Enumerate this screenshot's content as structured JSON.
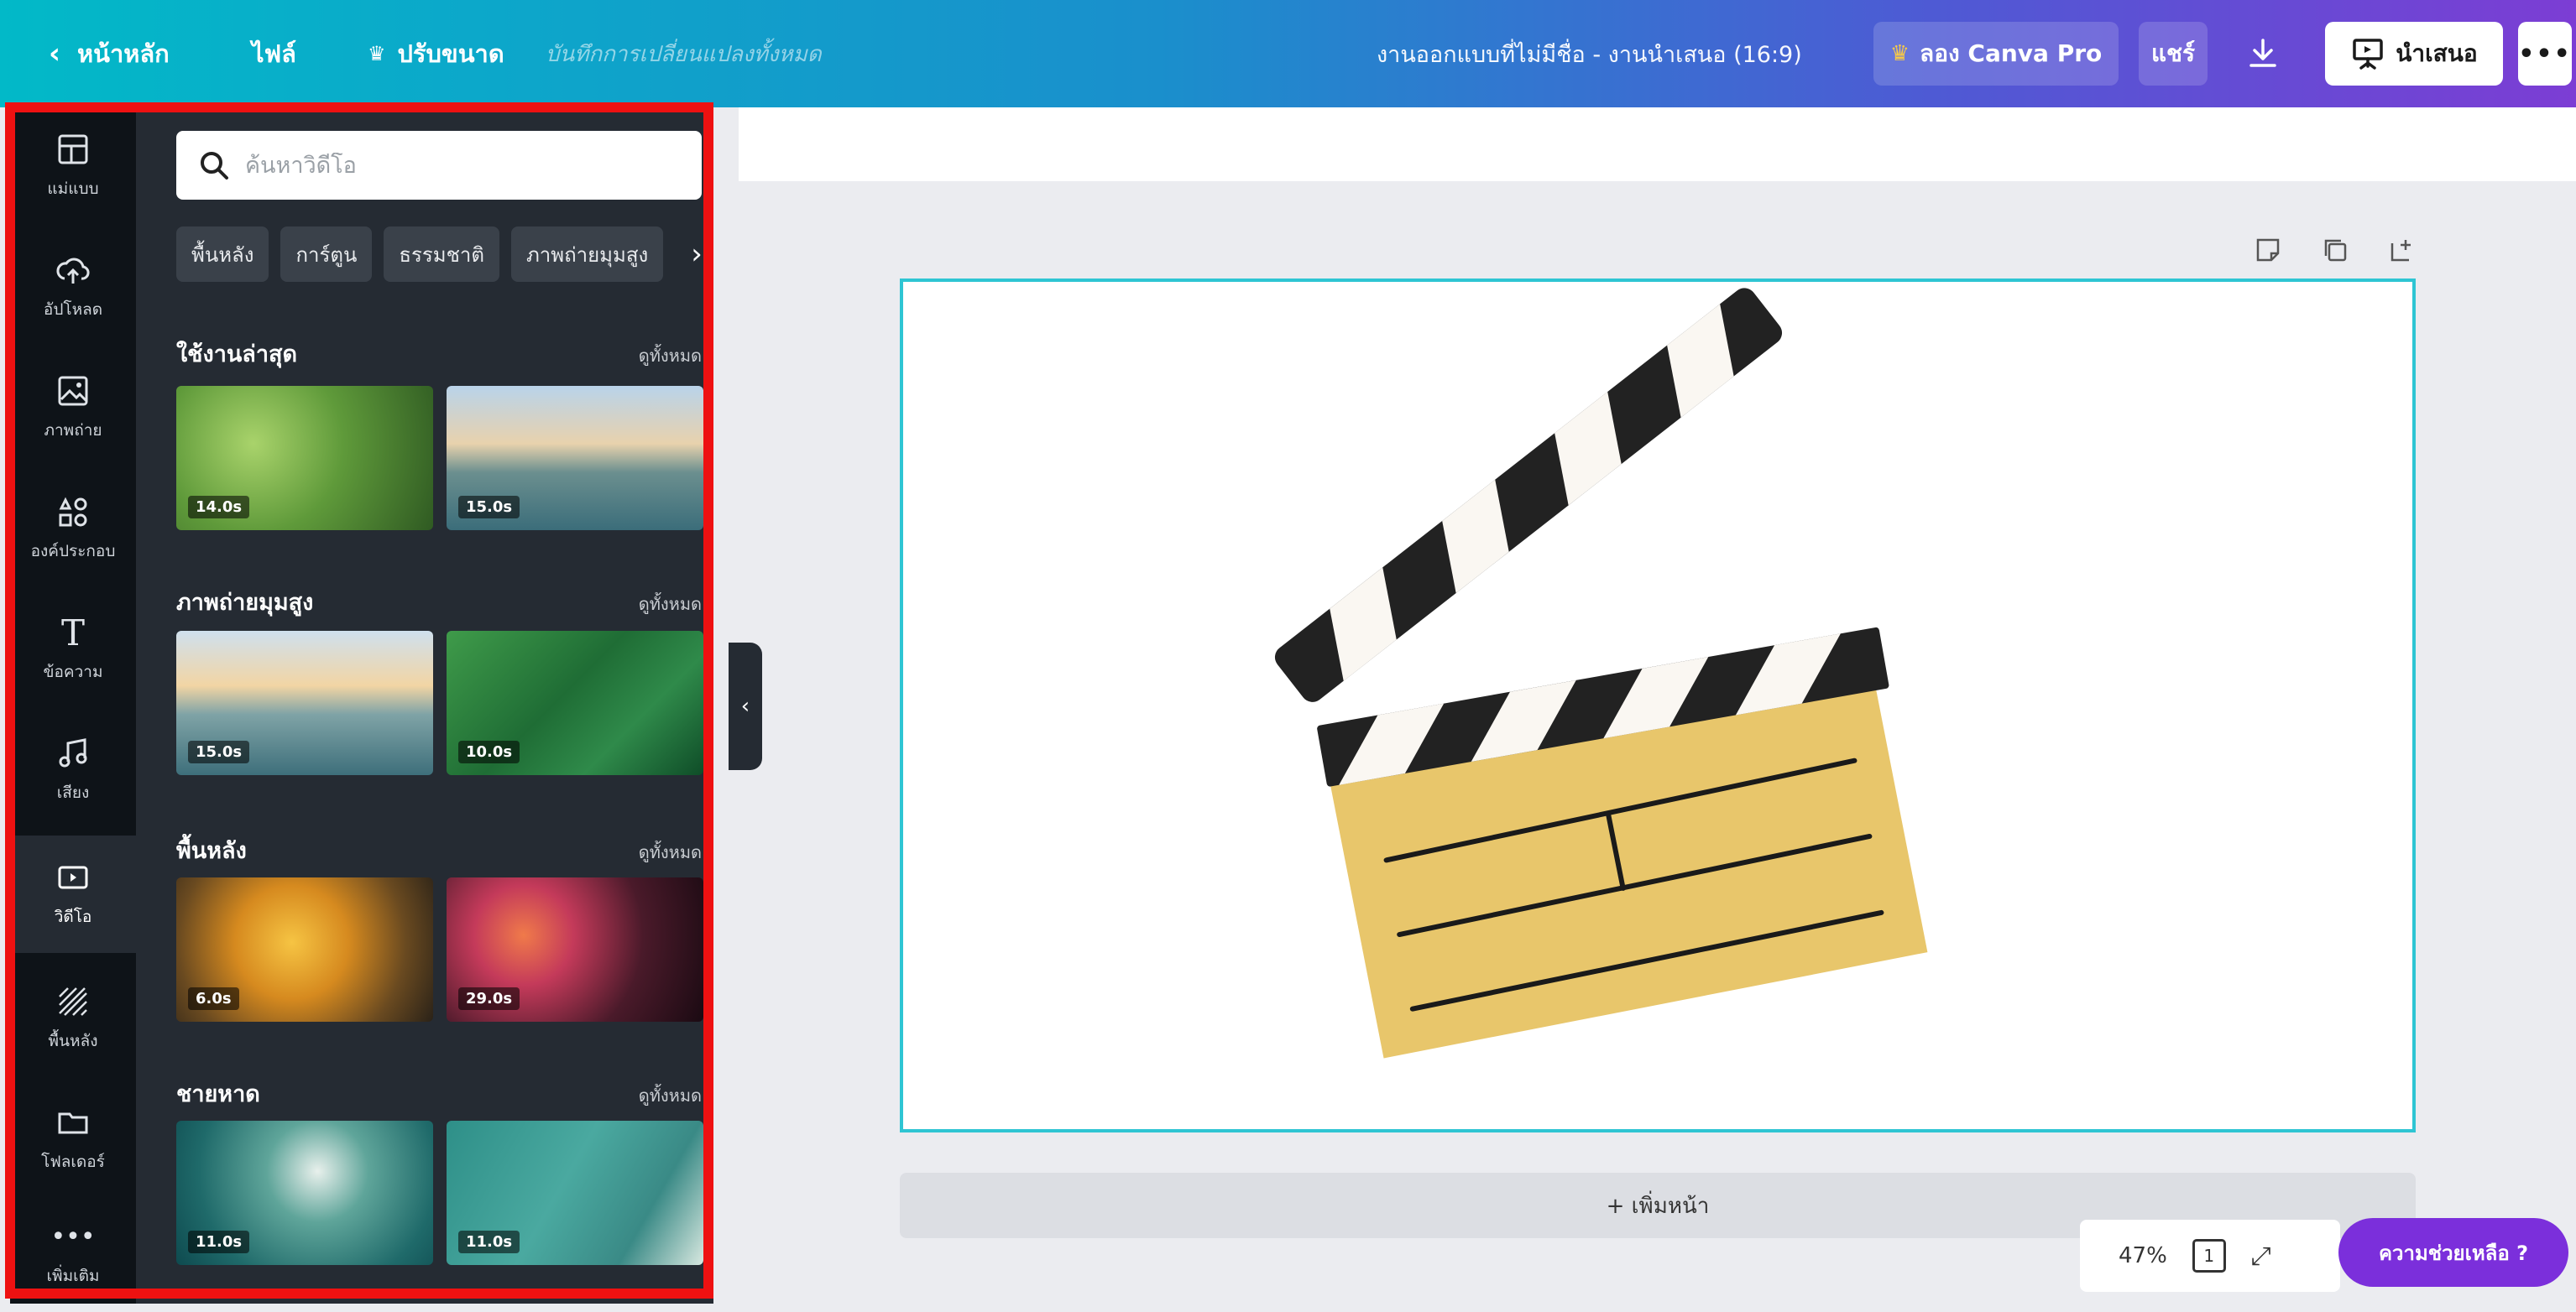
{
  "topbar": {
    "back_label": "หน้าหลัก",
    "file_label": "ไฟล์",
    "resize_label": "ปรับขนาด",
    "saved_status": "บันทึกการเปลี่ยนแปลงทั้งหมด",
    "doc_title": "งานออกแบบที่ไม่มีชื่อ - งานนำเสนอ (16:9)",
    "pro_label": "ลอง Canva Pro",
    "share_label": "แชร์",
    "present_label": "นำเสนอ",
    "more_label": "•••"
  },
  "rail": [
    {
      "label": "แม่แบบ",
      "icon": "template-icon"
    },
    {
      "label": "อัปโหลด",
      "icon": "upload-icon"
    },
    {
      "label": "ภาพถ่าย",
      "icon": "photo-icon"
    },
    {
      "label": "องค์ประกอบ",
      "icon": "elements-icon"
    },
    {
      "label": "ข้อความ",
      "icon": "text-icon"
    },
    {
      "label": "เสียง",
      "icon": "music-icon"
    },
    {
      "label": "วิดีโอ",
      "icon": "video-icon"
    },
    {
      "label": "พื้นหลัง",
      "icon": "background-icon"
    },
    {
      "label": "โฟลเดอร์",
      "icon": "folder-icon"
    },
    {
      "label": "เพิ่มเติม",
      "icon": "more-icon"
    }
  ],
  "panel": {
    "search_placeholder": "ค้นหาวิดีโอ",
    "chips": [
      "พื้นหลัง",
      "การ์ตูน",
      "ธรรมชาติ",
      "ภาพถ่ายมุมสูง"
    ],
    "see_all": "ดูทั้งหมด",
    "sections": [
      {
        "title": "ใช้งานล่าสุด",
        "durations": [
          "14.0s",
          "15.0s"
        ]
      },
      {
        "title": "ภาพถ่ายมุมสูง",
        "durations": [
          "15.0s",
          "10.0s"
        ]
      },
      {
        "title": "พื้นหลัง",
        "durations": [
          "6.0s",
          "29.0s"
        ]
      },
      {
        "title": "ชายหาด",
        "durations": [
          "11.0s",
          "11.0s"
        ]
      }
    ]
  },
  "canvas": {
    "add_page_label": "+ เพิ่มหน้า",
    "zoom": "47%",
    "page_count": "1",
    "help_label": "ความช่วยเหลือ ?"
  },
  "colors": {
    "accent": "#2ec5d3",
    "highlight": "#ee1111",
    "clapper_body": "#e8c66b",
    "help": "#7b2fdb"
  }
}
